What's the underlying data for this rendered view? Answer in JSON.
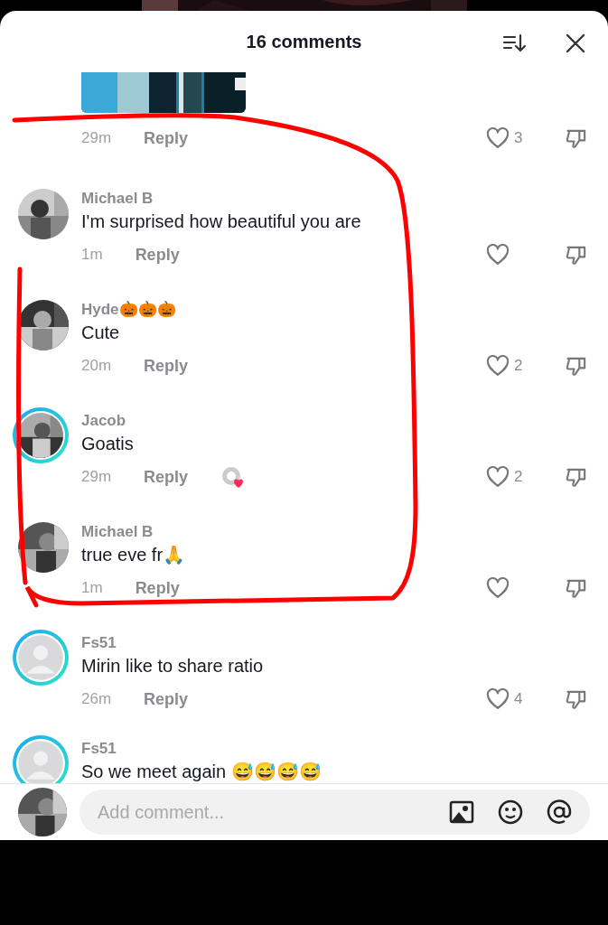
{
  "header": {
    "title": "16 comments"
  },
  "partial_comment": {
    "kind": "picture",
    "time": "29m",
    "reply": "Reply",
    "likes": "3"
  },
  "comments": [
    {
      "name": "Michael B",
      "text": "I'm surprised how beautiful you are",
      "time": "1m",
      "reply": "Reply",
      "default_avatar": false,
      "story_ring": false,
      "creator_liked": false
    },
    {
      "name": "Hyde🎃🎃🎃",
      "text": "Cute",
      "time": "20m",
      "reply": "Reply",
      "likes": "2",
      "default_avatar": false,
      "story_ring": false,
      "creator_liked": false
    },
    {
      "name": "Jacob",
      "text": "Goatis",
      "time": "29m",
      "reply": "Reply",
      "likes": "2",
      "default_avatar": false,
      "story_ring": true,
      "creator_liked": true
    },
    {
      "name": "Michael B",
      "text": "true eve fr🙏",
      "time": "1m",
      "reply": "Reply",
      "default_avatar": false,
      "story_ring": false,
      "creator_liked": false
    },
    {
      "name": "Fs51",
      "text": "Mirin like to share ratio",
      "time": "26m",
      "reply": "Reply",
      "likes": "4",
      "default_avatar": true,
      "story_ring": true,
      "creator_liked": false
    },
    {
      "name": "Fs51",
      "text": "So we meet again 😅😅😅😅",
      "default_avatar": true,
      "story_ring": true,
      "creator_liked": false
    }
  ],
  "composer": {
    "placeholder": "Add comment..."
  }
}
